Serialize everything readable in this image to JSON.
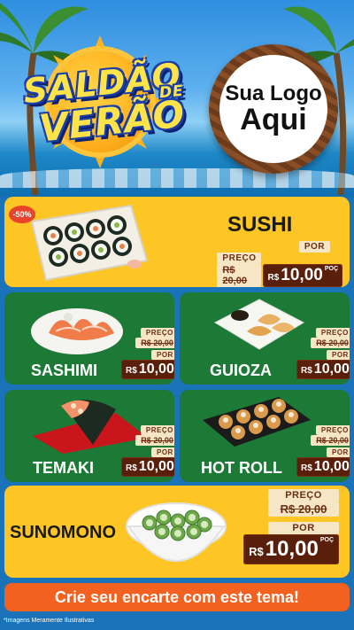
{
  "header": {
    "title_line1": "SALDÃO",
    "title_de": "DE",
    "title_line2": "VERÃO",
    "logo_line1": "Sua Logo",
    "logo_line2": "Aqui"
  },
  "labels": {
    "preco": "PREÇO",
    "por": "POR",
    "currency": "R$",
    "per": "POÇ"
  },
  "items": [
    {
      "name": "SUSHI",
      "discount": "-50%",
      "old_price": "20,00",
      "new_price": "10,00"
    },
    {
      "name": "SASHIMI",
      "old_price": "20,00",
      "new_price": "10,00"
    },
    {
      "name": "GUIOZA",
      "old_price": "20,00",
      "new_price": "10,00"
    },
    {
      "name": "TEMAKI",
      "old_price": "20,00",
      "new_price": "10,00"
    },
    {
      "name": "HOT ROLL",
      "old_price": "20,00",
      "new_price": "10,00"
    },
    {
      "name": "SUNOMONO",
      "old_price": "20,00",
      "new_price": "10,00"
    }
  ],
  "cta": "Crie seu encarte com este tema!",
  "footnote": "*Imagens Meramente Ilustrativas",
  "colors": {
    "yellow_card": "#fdc624",
    "green_card": "#1c7a36",
    "price_dark": "#5a1f0a",
    "cta_orange": "#f2611f",
    "background_blue": "#1a73b8"
  }
}
